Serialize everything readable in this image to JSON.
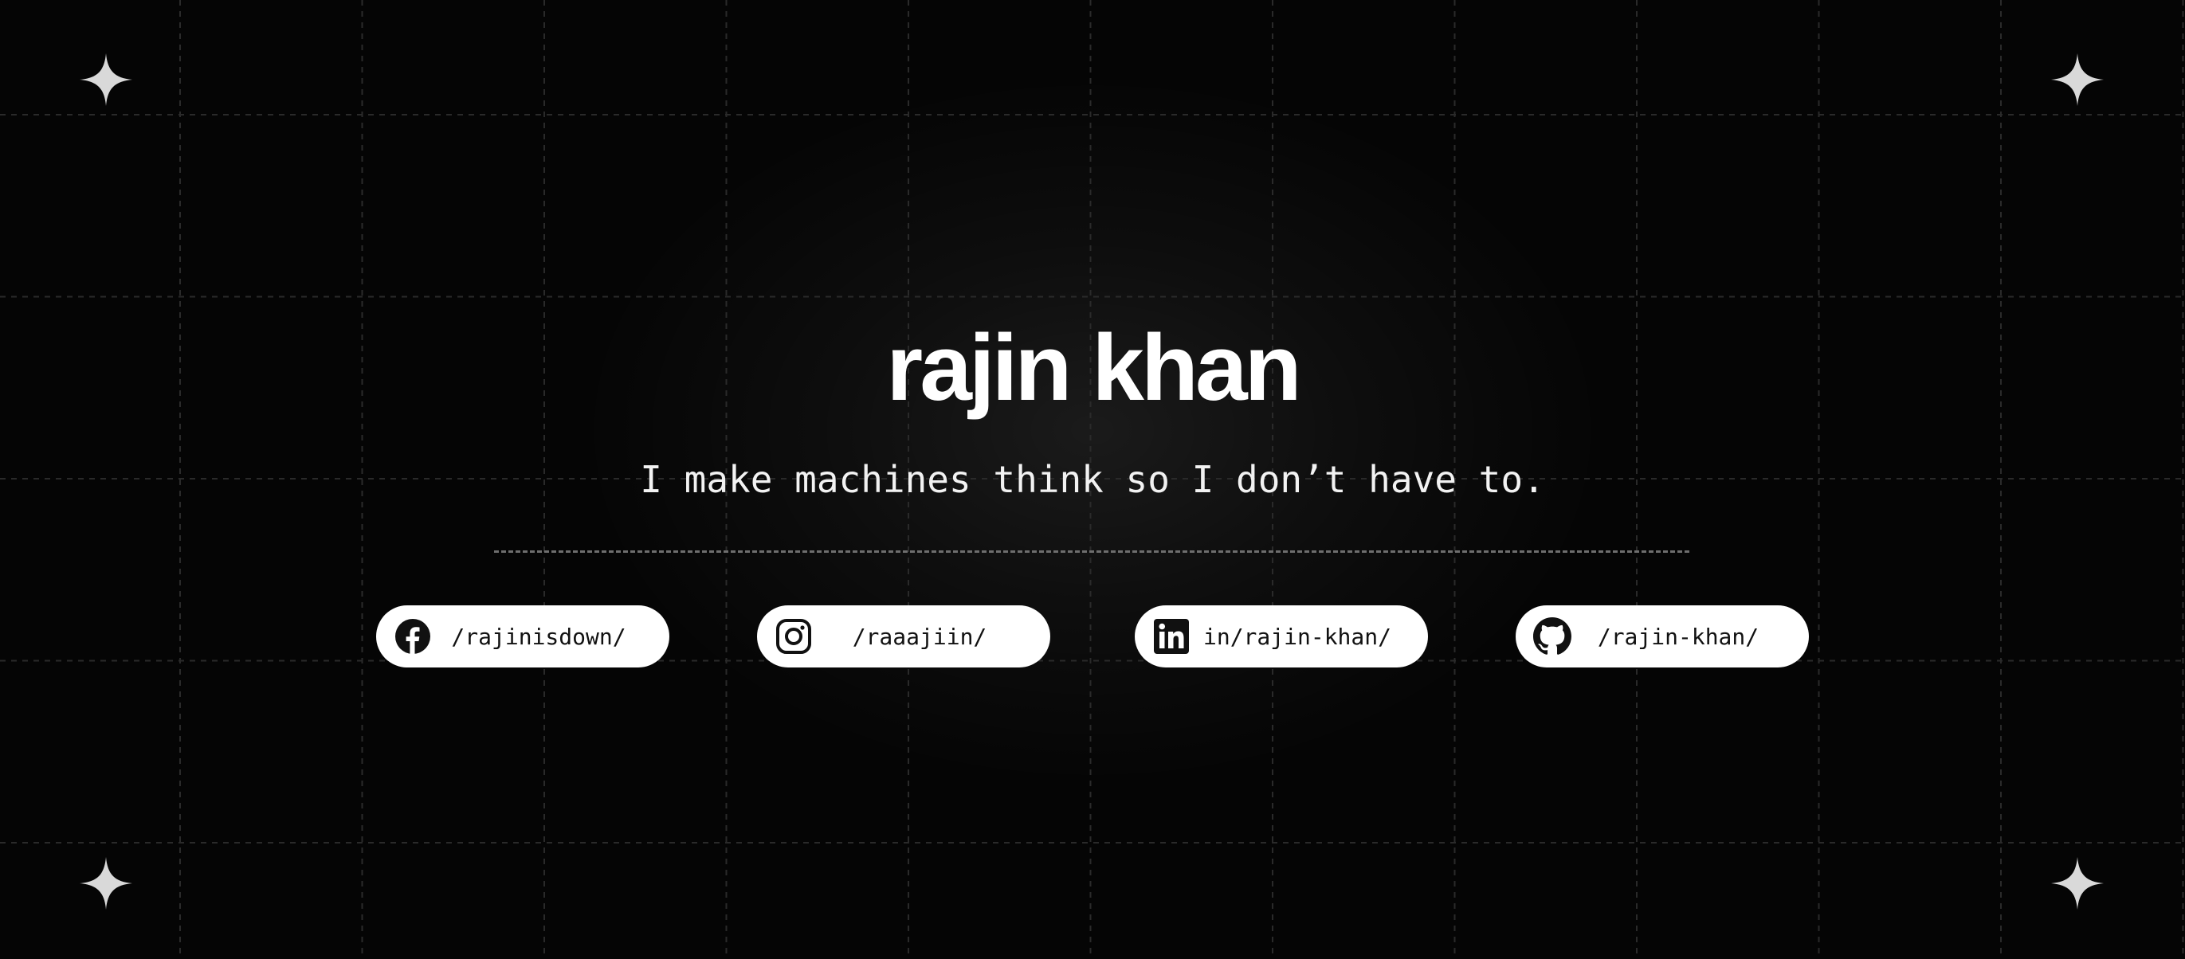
{
  "hero": {
    "name": "rajin khan",
    "tagline": "I make machines think so I don’t have to."
  },
  "socials": [
    {
      "icon": "facebook-icon",
      "handle": "/rajinisdown/"
    },
    {
      "icon": "instagram-icon",
      "handle": "/raaajiin/"
    },
    {
      "icon": "linkedin-icon",
      "handle": "in/rajin-khan/"
    },
    {
      "icon": "github-icon",
      "handle": "/rajin-khan/"
    }
  ],
  "decorations": {
    "corner_icon": "sparkle-icon"
  },
  "colors": {
    "background": "#050505",
    "text": "#ffffff",
    "pill_background": "#ffffff",
    "pill_text": "#111111",
    "grid_line": "#2a2a2a",
    "divider": "#6e6e6e",
    "sparkle": "#d9d9d9"
  }
}
